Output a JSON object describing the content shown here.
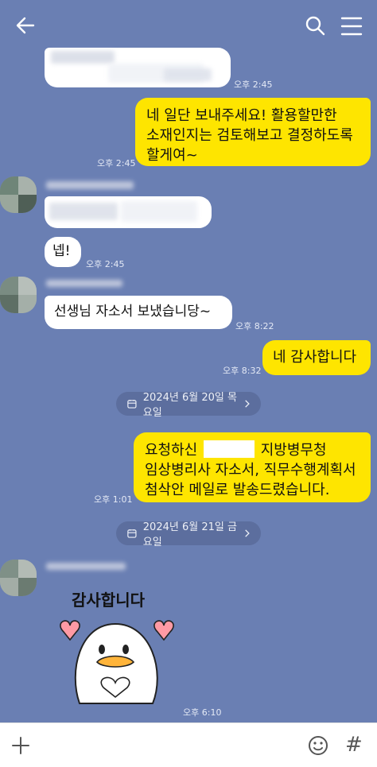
{
  "messages": {
    "m1_time": "오후 2:45",
    "m2_text": "네 일단 보내주세요! 활용할만한 소재인지는 검토해보고 결정하도록 할게여~",
    "m2_line1": "네 일단 보내주세요! 활용할만한",
    "m2_line2": "소재인지는 검토해보고 결정하도록",
    "m2_line3": "할게여~",
    "m2_time": "오후 2:45",
    "m4_text": "넵!",
    "m4_time": "오후 2:45",
    "m5_text": "선생님 자소서 보냈습니당~",
    "m5_time": "오후 8:22",
    "m6_text": "네 감사합니다",
    "m6_time": "오후 8:32",
    "m7_line1_pre": "요청하신",
    "m7_line1_post": "지방병무청",
    "m7_line2": "임상병리사 자소서, 직무수행계획서",
    "m7_line3": "첨삭안 메일로 발송드렸습니다.",
    "m7_time": "오후 1:01",
    "sticker_text": "감사합니다",
    "sticker_time": "오후 6:10"
  },
  "dates": {
    "d1": "2024년 6월 20일 목요일",
    "d2": "2024년 6월 21일 금요일"
  },
  "colors": {
    "background": "#6a7fb3",
    "my_bubble": "#fee500",
    "their_bubble": "#ffffff"
  },
  "icons": [
    "back-arrow-icon",
    "search-icon",
    "menu-icon",
    "calendar-icon",
    "chevron-right-icon",
    "plus-icon",
    "emoji-icon",
    "hash-icon"
  ]
}
